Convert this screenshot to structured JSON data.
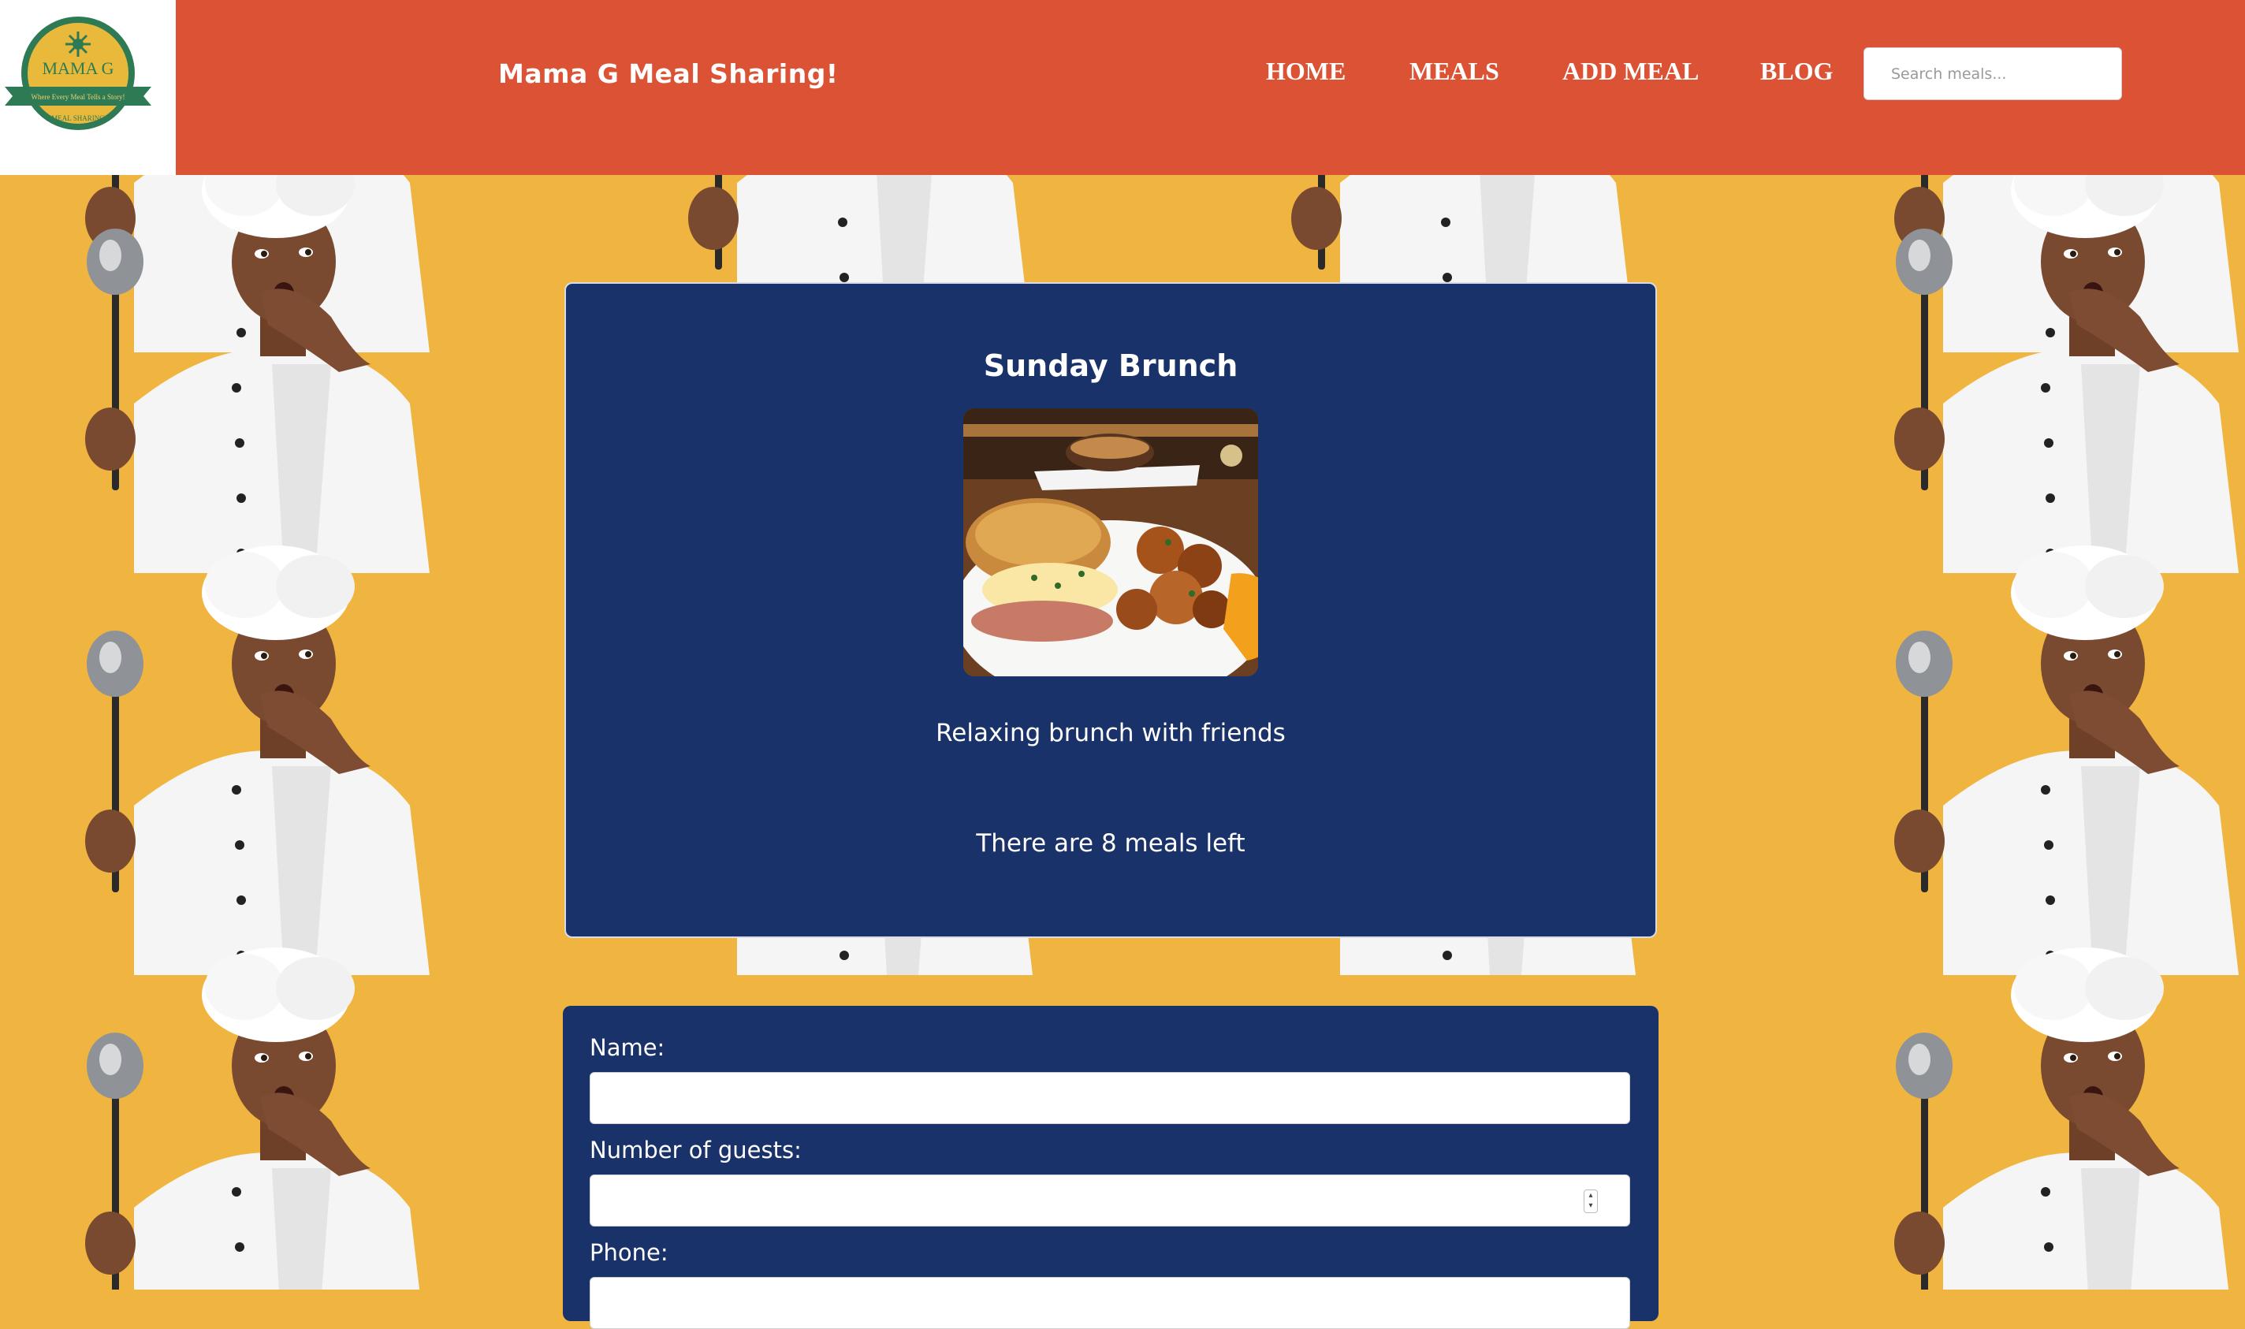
{
  "header": {
    "logo": {
      "title": "MAMA G",
      "tagline": "Where Every Meal Tells a Story!",
      "ribbon": "MEAL SHARING"
    },
    "brand": "Mama G Meal Sharing!",
    "nav": [
      {
        "label": "HOME"
      },
      {
        "label": "MEALS"
      },
      {
        "label": "ADD MEAL"
      },
      {
        "label": "BLOG"
      }
    ],
    "search": {
      "placeholder": "Search meals...",
      "value": ""
    }
  },
  "meal": {
    "title": "Sunday Brunch",
    "description": "Relaxing brunch with friends",
    "availability": "There are 8 meals left"
  },
  "form": {
    "name_label": "Name:",
    "guests_label": "Number of guests:",
    "phone_label": "Phone:"
  },
  "colors": {
    "header_bg": "#dc5234",
    "page_bg": "#f0b540",
    "card_bg": "#19326a",
    "logo_green": "#2e7a55",
    "logo_gold": "#e9b93b"
  }
}
